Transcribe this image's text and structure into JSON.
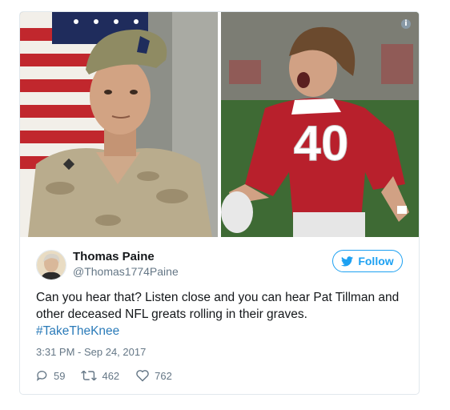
{
  "tweet": {
    "author_name": "Thomas Paine",
    "author_handle": "@Thomas1774Paine",
    "follow_label": "Follow",
    "text": "Can you hear that? Listen close and you can hear Pat Tillman and other deceased NFL greats rolling in their graves.",
    "hashtag": "#TakeTheKnee",
    "timestamp": "3:31 PM - Sep 24, 2017",
    "replies": "59",
    "retweets": "462",
    "likes": "762",
    "jersey_number": "40"
  },
  "colors": {
    "accent": "#1da1f2",
    "hashtag": "#2b7bb9",
    "muted": "#657786",
    "jersey_red": "#b8202c"
  },
  "icons": [
    "info-icon",
    "twitter-bird-icon",
    "reply-icon",
    "retweet-icon",
    "heart-icon"
  ]
}
